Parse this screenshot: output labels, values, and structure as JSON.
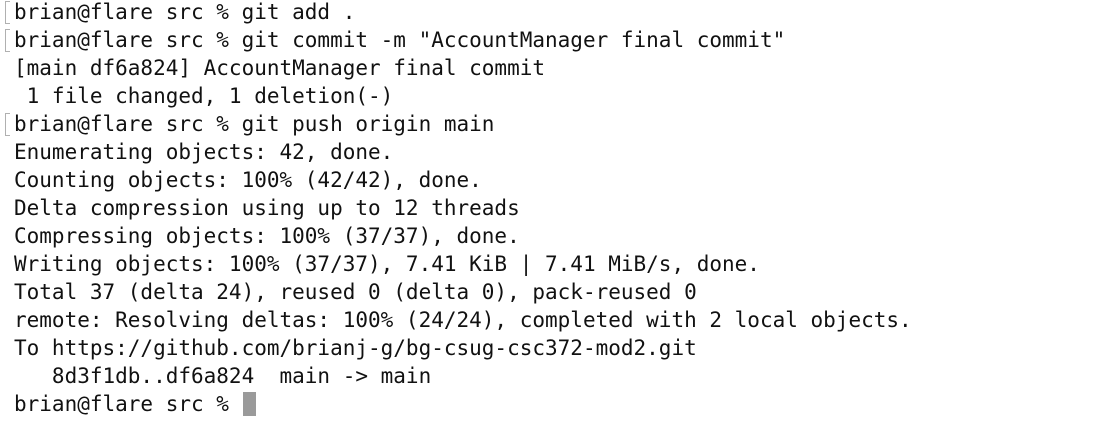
{
  "terminal": {
    "lines": [
      "brian@flare src % git add .",
      "brian@flare src % git commit -m \"AccountManager final commit\"",
      "[main df6a824] AccountManager final commit",
      " 1 file changed, 1 deletion(-)",
      "brian@flare src % git push origin main",
      "Enumerating objects: 42, done.",
      "Counting objects: 100% (42/42), done.",
      "Delta compression using up to 12 threads",
      "Compressing objects: 100% (37/37), done.",
      "Writing objects: 100% (37/37), 7.41 KiB | 7.41 MiB/s, done.",
      "Total 37 (delta 24), reused 0 (delta 0), pack-reused 0",
      "remote: Resolving deltas: 100% (24/24), completed with 2 local objects.",
      "To https://github.com/brianj-g/bg-csug-csc372-mod2.git",
      "   8d3f1db..df6a824  main -> main"
    ],
    "prompt": "brian@flare src % "
  }
}
